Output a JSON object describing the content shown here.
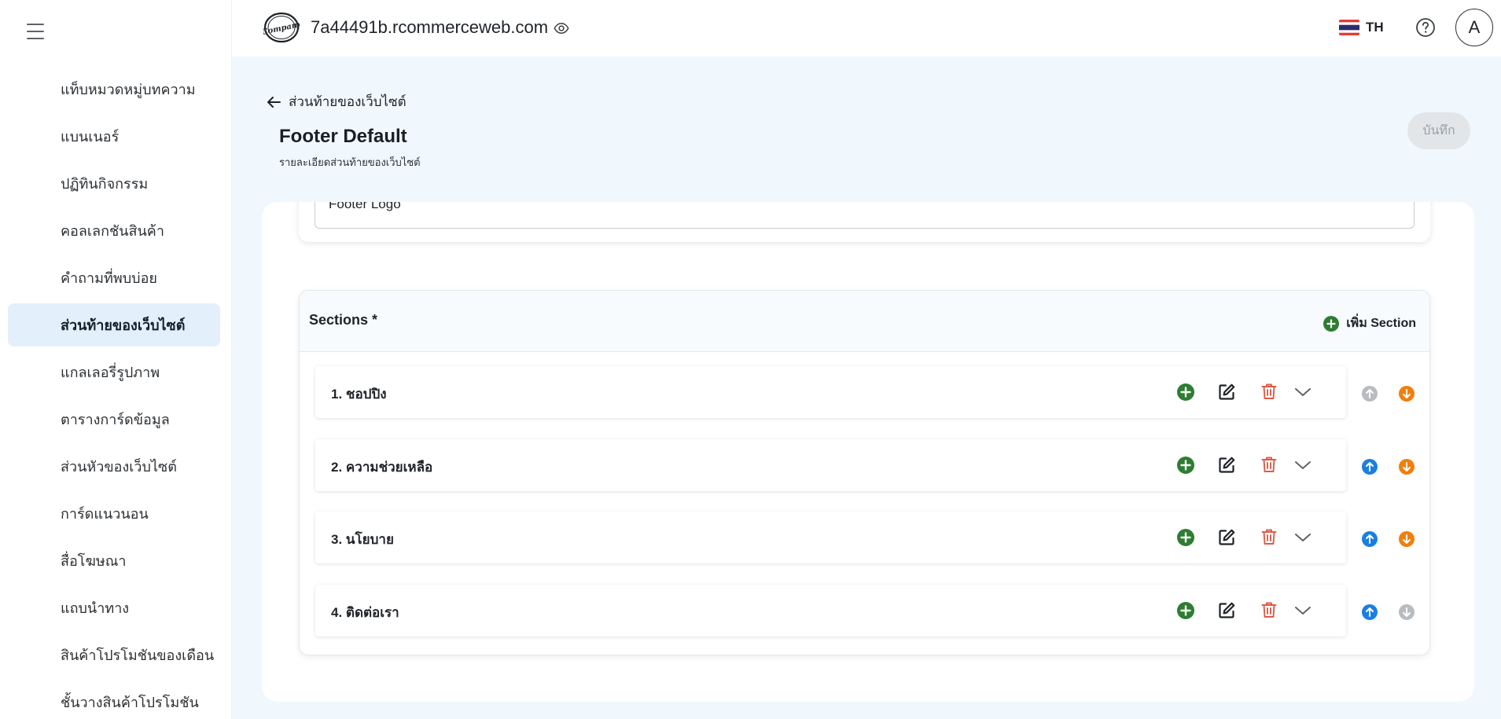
{
  "sidebar": {
    "items": [
      {
        "label": "แท็บหมวดหมู่บทความ",
        "active": false
      },
      {
        "label": "แบนเนอร์",
        "active": false
      },
      {
        "label": "ปฏิทินกิจกรรม",
        "active": false
      },
      {
        "label": "คอลเลกชันสินค้า",
        "active": false
      },
      {
        "label": "คำถามที่พบบ่อย",
        "active": false
      },
      {
        "label": "ส่วนท้ายของเว็บไซต์",
        "active": true
      },
      {
        "label": "แกลเลอรี่รูปภาพ",
        "active": false
      },
      {
        "label": "ตารางการ์ดข้อมูล",
        "active": false
      },
      {
        "label": "ส่วนหัวของเว็บไซต์",
        "active": false
      },
      {
        "label": "การ์ดแนวนอน",
        "active": false
      },
      {
        "label": "สื่อโฆษณา",
        "active": false
      },
      {
        "label": "แถบนำทาง",
        "active": false
      },
      {
        "label": "สินค้าโปรโมชันของเดือน",
        "active": false
      },
      {
        "label": "ชั้นวางสินค้าโปรโมชัน",
        "active": false
      }
    ]
  },
  "header": {
    "logo_text": "Company",
    "domain": "7a44491b.rcommerceweb.com",
    "language": "TH",
    "avatar_initial": "A"
  },
  "page": {
    "back_label": "ส่วนท้ายของเว็บไซต์",
    "title": "Footer Default",
    "subtitle": "รายละเอียดส่วนท้ายของเว็บไซต์",
    "save_label": "บันทึก",
    "logo_field_value": "Footer Logo"
  },
  "sections": {
    "title": "Sections *",
    "add_label": "เพิ่ม Section",
    "items": [
      {
        "label": "1. ชอปปิง",
        "up_enabled": false,
        "down_enabled": true
      },
      {
        "label": "2. ความช่วยเหลือ",
        "up_enabled": true,
        "down_enabled": true
      },
      {
        "label": "3. นโยบาย",
        "up_enabled": true,
        "down_enabled": true
      },
      {
        "label": "4. ติดต่อเรา",
        "up_enabled": true,
        "down_enabled": false
      }
    ]
  },
  "colors": {
    "add_green": "#2e7d32",
    "delete_red": "#e05a47",
    "move_up_blue": "#1a7fe0",
    "move_down_orange": "#f07f0c",
    "disabled_gray": "#b8bcc0",
    "active_nav_bg": "#e3f0fb",
    "main_bg": "#f0f8fd"
  },
  "icons": {
    "menu": "hamburger-icon",
    "visibility": "eye-icon",
    "help": "question-circle-icon",
    "back": "arrow-left-icon",
    "add": "plus-circle-icon",
    "edit": "edit-icon",
    "delete": "trash-icon",
    "expand": "chevron-down-icon",
    "move_up": "arrow-up-circle-icon",
    "move_down": "arrow-down-circle-icon"
  }
}
